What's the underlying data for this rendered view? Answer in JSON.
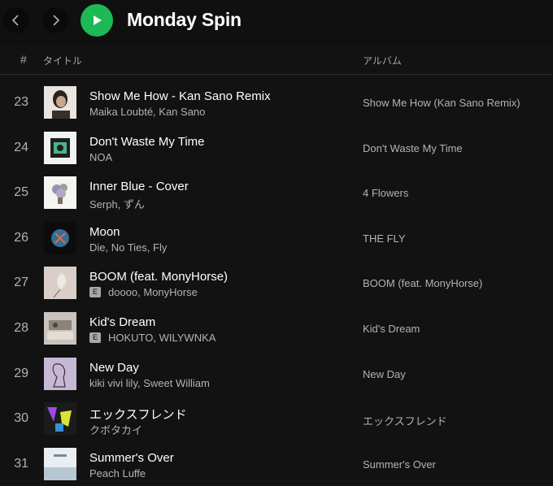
{
  "header": {
    "title": "Monday Spin"
  },
  "columns": {
    "number": "#",
    "title": "タイトル",
    "album": "アルバム"
  },
  "tracks": [
    {
      "number": "23",
      "title": "Show Me How - Kan Sano Remix",
      "artists": "Maika Loubté, Kan Sano",
      "explicit": "",
      "album": "Show Me How (Kan Sano Remix)"
    },
    {
      "number": "24",
      "title": "Don't Waste My Time",
      "artists": "NOA",
      "explicit": "",
      "album": "Don't Waste My Time"
    },
    {
      "number": "25",
      "title": "Inner Blue - Cover",
      "artists": "Serph, ずん",
      "explicit": "",
      "album": "4 Flowers"
    },
    {
      "number": "26",
      "title": "Moon",
      "artists": "Die, No Ties, Fly",
      "explicit": "",
      "album": "THE FLY"
    },
    {
      "number": "27",
      "title": "BOOM (feat. MonyHorse)",
      "artists": "doooo, MonyHorse",
      "explicit": "E",
      "album": "BOOM (feat. MonyHorse)"
    },
    {
      "number": "28",
      "title": "Kid's Dream",
      "artists": "HOKUTO, WILYWNKA",
      "explicit": "E",
      "album": "Kid's Dream"
    },
    {
      "number": "29",
      "title": "New Day",
      "artists": "kiki vivi lily, Sweet William",
      "explicit": "",
      "album": "New Day"
    },
    {
      "number": "30",
      "title": "エックスフレンド",
      "artists": "クボタカイ",
      "explicit": "",
      "album": "エックスフレンド"
    },
    {
      "number": "31",
      "title": "Summer's Over",
      "artists": "Peach Luffe",
      "explicit": "",
      "album": "Summer's Over"
    }
  ],
  "colors": {
    "accent": "#1db954",
    "background": "#121212",
    "secondary_text": "#b3b3b3"
  }
}
